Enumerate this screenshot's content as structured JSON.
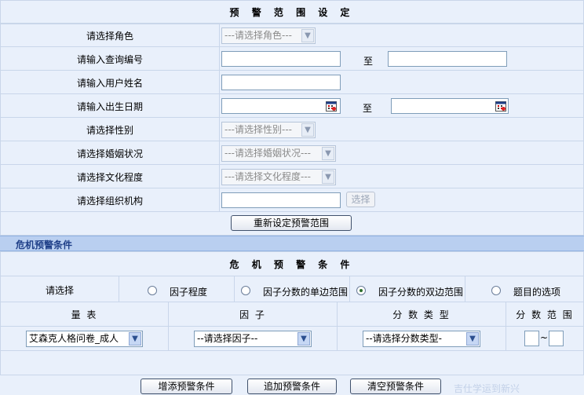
{
  "range_section": {
    "title": "预 警 范 围 设 定",
    "rows": [
      {
        "label": "请选择角色",
        "select": "---请选择角色---"
      },
      {
        "label": "请输入查询编号",
        "to": "至"
      },
      {
        "label": "请输入用户姓名"
      },
      {
        "label": "请输入出生日期",
        "to": "至"
      },
      {
        "label": "请选择性别",
        "select": "---请选择性别---"
      },
      {
        "label": "请选择婚姻状况",
        "select": "---请选择婚姻状况---"
      },
      {
        "label": "请选择文化程度",
        "select": "---请选择文化程度---"
      },
      {
        "label": "请选择组织机构",
        "button": "选择"
      }
    ],
    "reset_button": "重新设定预警范围"
  },
  "crisis_band": "危机预警条件",
  "crisis_section": {
    "title": "危 机 预 警 条 件",
    "choose_label": "请选择",
    "radios": [
      {
        "label": "因子程度",
        "checked": false
      },
      {
        "label": "因子分数的单边范围",
        "checked": false
      },
      {
        "label": "因子分数的双边范围",
        "checked": true
      },
      {
        "label": "题目的选项",
        "checked": false
      }
    ],
    "headers": [
      "量 表",
      "因 子",
      "分 数 类 型",
      "分 数 范 围"
    ],
    "scale_select": "艾森克人格问卷_成人",
    "factor_select": "--请选择因子--",
    "score_type_select": "--请选择分数类型-",
    "range_sep": "~"
  },
  "buttons": {
    "add": "增添预警条件",
    "append": "追加预警条件",
    "clear": "清空预警条件"
  },
  "watermark": "吉仕学运到新兴"
}
